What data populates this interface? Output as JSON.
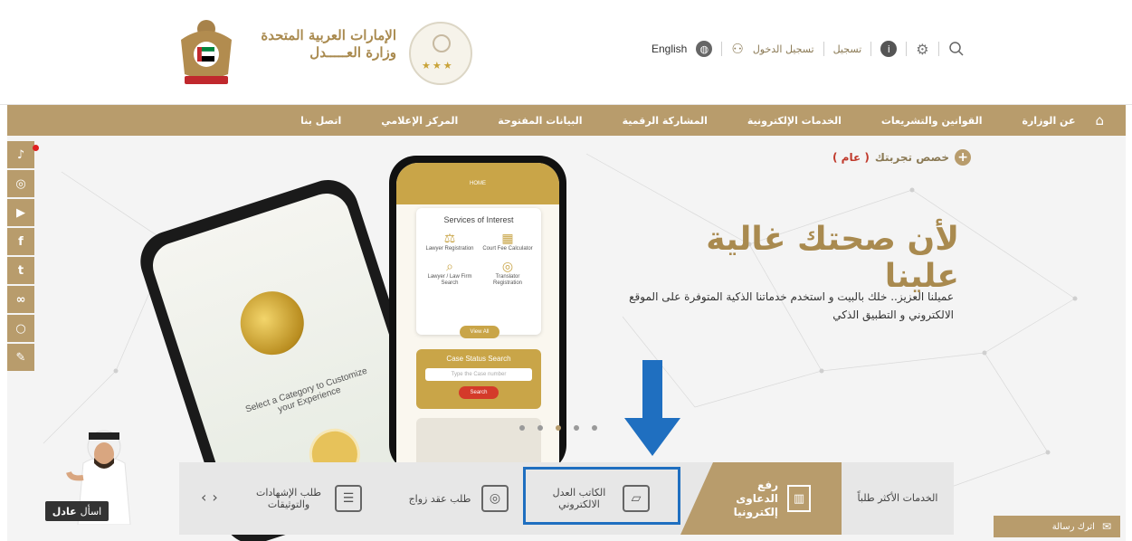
{
  "header": {
    "ministry_line1": "الإمارات العربية المتحدة",
    "ministry_line2": "وزارة العـــــدل",
    "toolbar": {
      "english": "English",
      "login": "تسجيل الدخول",
      "register": "تسجيل"
    }
  },
  "nav": {
    "items": [
      "عن الوزارة",
      "القوانين والتشريعات",
      "الخدمات الإلكترونية",
      "المشاركة الرقمية",
      "البيانات المفتوحة",
      "المركز الإعلامي",
      "اتصل بنا"
    ]
  },
  "social": [
    "bell-icon",
    "instagram-icon",
    "youtube-icon",
    "facebook-icon",
    "twitter-icon",
    "tripadvisor-icon",
    "chat-icon",
    "feedback-icon"
  ],
  "hero": {
    "customize_label": "خصص تجربتك",
    "customize_mode": "( عام )",
    "headline": "لأن صحتك غالية علينا",
    "subline": "عميلنا العزيز.. خلك بالبيت و استخدم خدماتنا الذكية المتوفرة على الموقع الالكتروني و التطبيق الذكي"
  },
  "phone_back": {
    "text": "Select a Category to Customize your Experience"
  },
  "phone_front": {
    "topbar": "HOME",
    "services_title": "Services of Interest",
    "services": [
      {
        "icon": "⚖",
        "label": "Lawyer Registration"
      },
      {
        "icon": "▦",
        "label": "Court Fee Calculator"
      },
      {
        "icon": "⌕",
        "label": "Lawyer / Law Firm Search"
      },
      {
        "icon": "◎",
        "label": "Translator Registration"
      }
    ],
    "view_all": "View All",
    "case_title": "Case Status Search",
    "case_placeholder": "Type the Case number",
    "search_btn": "Search"
  },
  "avatar": {
    "ask_prefix": "اسأل",
    "ask_name": "عادل"
  },
  "services_bar": {
    "tab_label": "الخدمات الأكثر طلباً",
    "featured": "رفع الدعاوى إلكترونيا",
    "items": [
      "الكاتب العدل الالكتروني",
      "طلب عقد زواج",
      "طلب الإشهادات والتوثيقات"
    ]
  },
  "leave_message": "اترك رسالة",
  "colors": {
    "gold": "#b89c6c",
    "highlight": "#1f6fc0",
    "arrow": "#1f6fc0"
  }
}
